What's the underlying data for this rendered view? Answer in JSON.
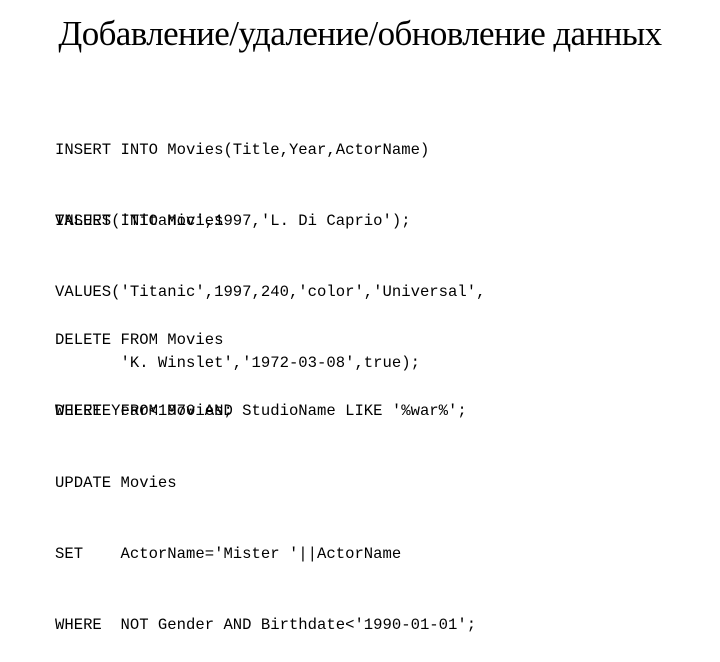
{
  "title": "Добавление/удаление/обновление данных",
  "blocks": [
    {
      "name": "insert-example-1",
      "lines": [
        "INSERT INTO Movies(Title,Year,ActorName)",
        "VALUES('Titanic',1997,'L. Di Caprio');"
      ]
    },
    {
      "name": "insert-example-2",
      "lines": [
        "INSERT INTO Movies",
        "VALUES('Titanic',1997,240,'color','Universal',",
        "       'K. Winslet','1972-03-08',true);"
      ]
    },
    {
      "name": "delete-example-1",
      "lines": [
        "DELETE FROM Movies",
        "WHERE Year<1970 AND StudioName LIKE '%war%';"
      ]
    },
    {
      "name": "delete-example-2",
      "lines": [
        "DELETE FROM Movies;"
      ]
    },
    {
      "name": "update-example",
      "lines": [
        "UPDATE Movies",
        "SET    ActorName='Mister '||ActorName",
        "WHERE  NOT Gender AND Birthdate<'1990-01-01';"
      ]
    }
  ]
}
